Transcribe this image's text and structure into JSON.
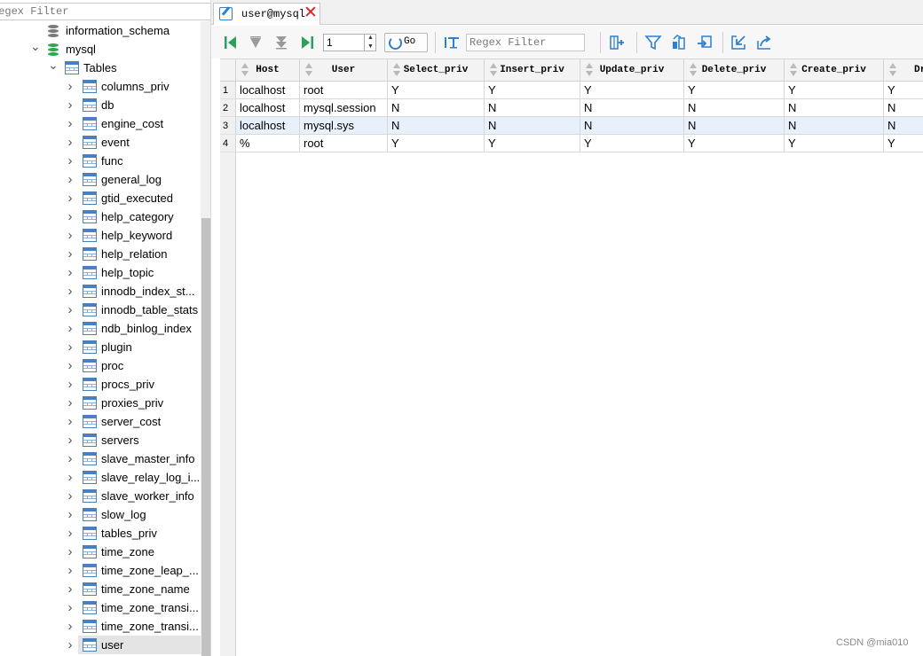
{
  "sidebar": {
    "filter_placeholder": "Regex Filter",
    "tree": [
      {
        "label": "information_schema",
        "type": "database",
        "depth": 1,
        "expander": "",
        "color": "#7a7a7a"
      },
      {
        "label": "mysql",
        "type": "database",
        "depth": 1,
        "expander": "open",
        "color": "#2fa84f"
      },
      {
        "label": "Tables",
        "type": "folder",
        "depth": 2,
        "expander": "open"
      },
      {
        "label": "columns_priv",
        "type": "table",
        "depth": 3,
        "expander": "closed"
      },
      {
        "label": "db",
        "type": "table",
        "depth": 3,
        "expander": "closed"
      },
      {
        "label": "engine_cost",
        "type": "table",
        "depth": 3,
        "expander": "closed"
      },
      {
        "label": "event",
        "type": "table",
        "depth": 3,
        "expander": "closed"
      },
      {
        "label": "func",
        "type": "table",
        "depth": 3,
        "expander": "closed"
      },
      {
        "label": "general_log",
        "type": "table",
        "depth": 3,
        "expander": "closed"
      },
      {
        "label": "gtid_executed",
        "type": "table",
        "depth": 3,
        "expander": "closed"
      },
      {
        "label": "help_category",
        "type": "table",
        "depth": 3,
        "expander": "closed"
      },
      {
        "label": "help_keyword",
        "type": "table",
        "depth": 3,
        "expander": "closed"
      },
      {
        "label": "help_relation",
        "type": "table",
        "depth": 3,
        "expander": "closed"
      },
      {
        "label": "help_topic",
        "type": "table",
        "depth": 3,
        "expander": "closed"
      },
      {
        "label": "innodb_index_st...",
        "type": "table",
        "depth": 3,
        "expander": "closed"
      },
      {
        "label": "innodb_table_stats",
        "type": "table",
        "depth": 3,
        "expander": "closed"
      },
      {
        "label": "ndb_binlog_index",
        "type": "table",
        "depth": 3,
        "expander": "closed"
      },
      {
        "label": "plugin",
        "type": "table",
        "depth": 3,
        "expander": "closed"
      },
      {
        "label": "proc",
        "type": "table",
        "depth": 3,
        "expander": "closed"
      },
      {
        "label": "procs_priv",
        "type": "table",
        "depth": 3,
        "expander": "closed"
      },
      {
        "label": "proxies_priv",
        "type": "table",
        "depth": 3,
        "expander": "closed"
      },
      {
        "label": "server_cost",
        "type": "table",
        "depth": 3,
        "expander": "closed"
      },
      {
        "label": "servers",
        "type": "table",
        "depth": 3,
        "expander": "closed"
      },
      {
        "label": "slave_master_info",
        "type": "table",
        "depth": 3,
        "expander": "closed"
      },
      {
        "label": "slave_relay_log_i...",
        "type": "table",
        "depth": 3,
        "expander": "closed"
      },
      {
        "label": "slave_worker_info",
        "type": "table",
        "depth": 3,
        "expander": "closed"
      },
      {
        "label": "slow_log",
        "type": "table",
        "depth": 3,
        "expander": "closed"
      },
      {
        "label": "tables_priv",
        "type": "table",
        "depth": 3,
        "expander": "closed"
      },
      {
        "label": "time_zone",
        "type": "table",
        "depth": 3,
        "expander": "closed"
      },
      {
        "label": "time_zone_leap_...",
        "type": "table",
        "depth": 3,
        "expander": "closed"
      },
      {
        "label": "time_zone_name",
        "type": "table",
        "depth": 3,
        "expander": "closed"
      },
      {
        "label": "time_zone_transi...",
        "type": "table",
        "depth": 3,
        "expander": "closed"
      },
      {
        "label": "time_zone_transi...",
        "type": "table",
        "depth": 3,
        "expander": "closed"
      },
      {
        "label": "user",
        "type": "table",
        "depth": 3,
        "expander": "closed",
        "selected": true
      }
    ]
  },
  "tab": {
    "title": "user@mysql",
    "edit_icon": "edit-icon",
    "close_icon": "close-icon"
  },
  "toolbar": {
    "page_value": "1",
    "go_label": "Go",
    "regex_placeholder": "Regex Filter",
    "icons": [
      "first-page-icon",
      "previous-page-icon",
      "next-page-icon",
      "last-page-icon",
      "refresh-icon",
      "filter-text-icon",
      "add-column-icon",
      "filter-icon",
      "sort-icon",
      "export-icon",
      "import-icon",
      "share-icon"
    ]
  },
  "grid": {
    "columns": [
      "Host",
      "User",
      "Select_priv",
      "Insert_priv",
      "Update_priv",
      "Delete_priv",
      "Create_priv",
      "Dr"
    ],
    "rows": [
      {
        "num": "1",
        "cells": [
          "localhost",
          "root",
          "Y",
          "Y",
          "Y",
          "Y",
          "Y",
          "Y"
        ]
      },
      {
        "num": "2",
        "cells": [
          "localhost",
          "mysql.session",
          "N",
          "N",
          "N",
          "N",
          "N",
          "N"
        ]
      },
      {
        "num": "3",
        "cells": [
          "localhost",
          "mysql.sys",
          "N",
          "N",
          "N",
          "N",
          "N",
          "N"
        ],
        "highlighted": true
      },
      {
        "num": "4",
        "cells": [
          "%",
          "root",
          "Y",
          "Y",
          "Y",
          "Y",
          "Y",
          "Y"
        ]
      }
    ]
  },
  "watermark": "CSDN @mia010",
  "colors": {
    "accent": "#2f7fd3",
    "close_red": "#e02020",
    "db_green": "#2fa84f",
    "selected_row": "#e8f1fb"
  }
}
